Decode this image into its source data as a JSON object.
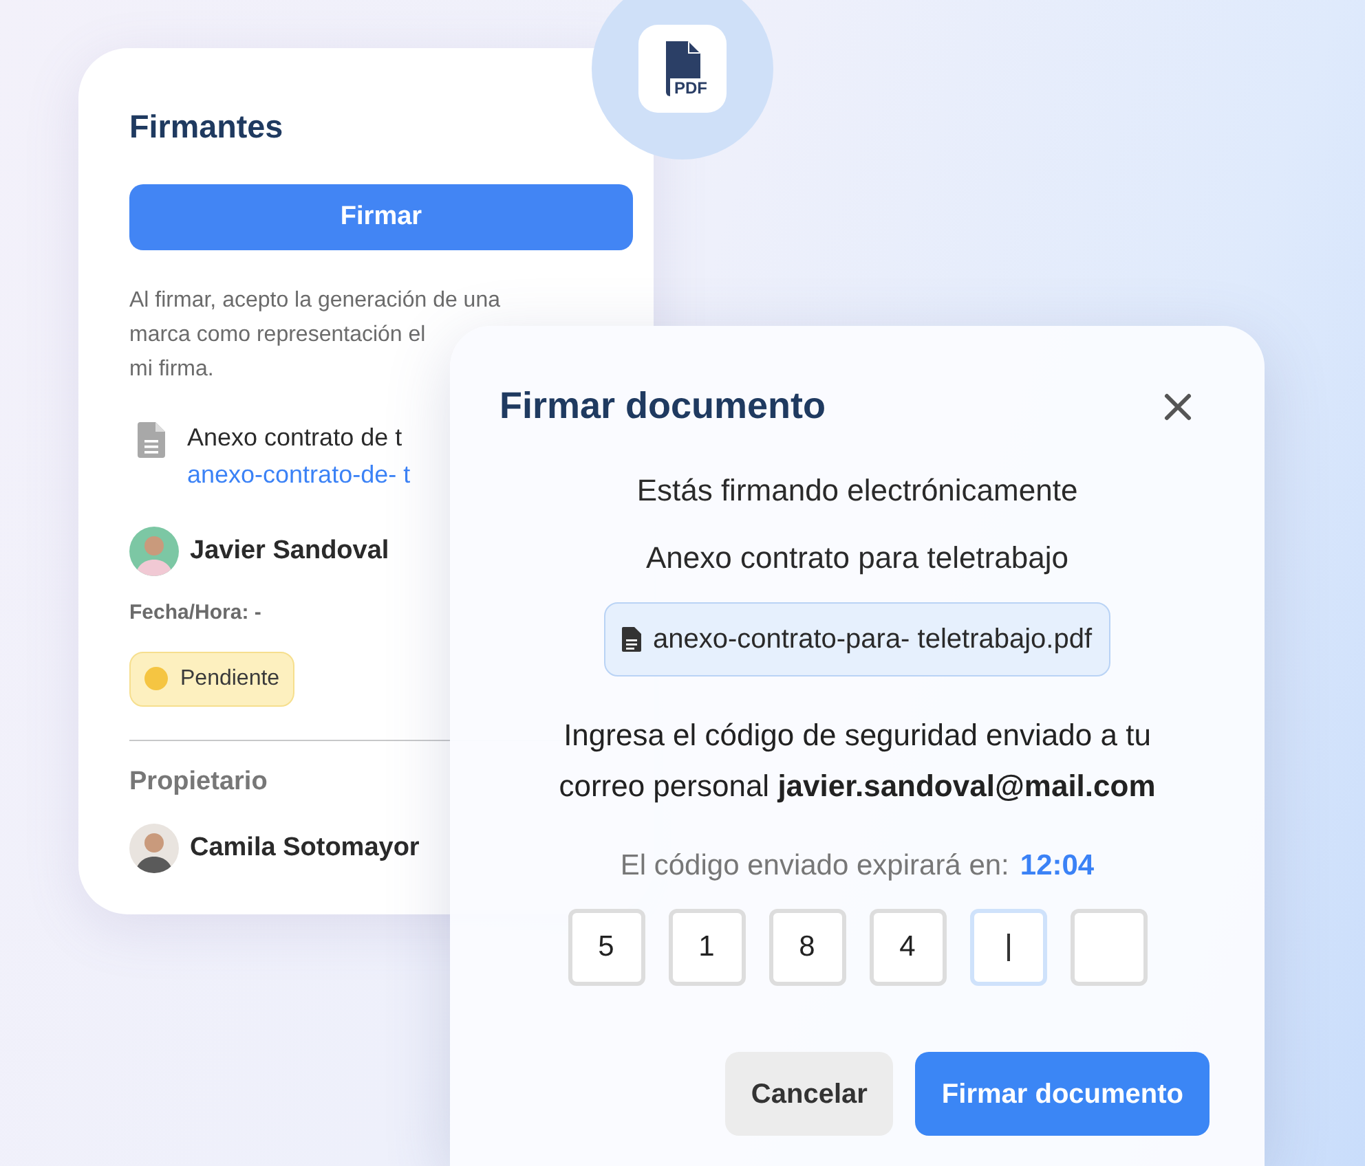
{
  "pdf_badge": {
    "label": "PDF"
  },
  "signers_panel": {
    "title": "Firmantes",
    "sign_button": "Firmar",
    "consent_lines": [
      "Al firmar, acepto la generación de una",
      "marca como representación el",
      "mi firma."
    ],
    "document": {
      "title": "Anexo contrato de t",
      "file_link": "anexo-contrato-de- t"
    },
    "signer": {
      "name": "Javier Sandoval",
      "datetime": "Fecha/Hora: -",
      "status": {
        "label": "Pendiente",
        "color": "#f5c542"
      }
    },
    "owner_heading": "Propietario",
    "owner": {
      "name": "Camila Sotomayor"
    }
  },
  "sign_dialog": {
    "title": "Firmar documento",
    "intro": "Estás firmando electrónicamente",
    "document_title": "Anexo contrato para teletrabajo",
    "file_name": "anexo-contrato-para- teletrabajo.pdf",
    "instruction": "Ingresa el código de seguridad enviado a tu correo personal **javier.sandoval@mail.com**",
    "timer_label": "El código enviado expirará en:",
    "timer_value": "12:04",
    "code_digits": [
      {
        "value": "5",
        "focused": false
      },
      {
        "value": "1",
        "focused": false
      },
      {
        "value": "8",
        "focused": false
      },
      {
        "value": "4",
        "focused": false
      },
      {
        "focused": true
      },
      {
        "focused": false
      }
    ],
    "buttons": [
      {
        "label": "Cancelar",
        "kind": "secondary"
      },
      {
        "label": "Firmar documento",
        "kind": "primary"
      }
    ]
  }
}
